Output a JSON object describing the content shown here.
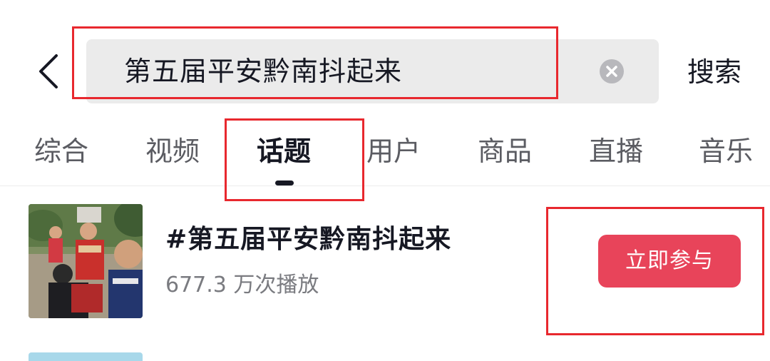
{
  "header": {
    "back_icon": "chevron-left-icon",
    "search_value": "第五届平安黔南抖起来",
    "clear_icon": "close-circle-icon",
    "search_button_label": "搜索"
  },
  "tabs": [
    {
      "label": "综合",
      "active": false
    },
    {
      "label": "视频",
      "active": false
    },
    {
      "label": "话题",
      "active": true
    },
    {
      "label": "用户",
      "active": false
    },
    {
      "label": "商品",
      "active": false
    },
    {
      "label": "直播",
      "active": false
    },
    {
      "label": "音乐",
      "active": false
    }
  ],
  "result": {
    "topic_title": "#第五届平安黔南抖起来",
    "views": "677.3 万次播放",
    "join_button_label": "立即参与"
  },
  "colors": {
    "accent": "#e8445a",
    "highlight_box": "#e8282e",
    "search_bg": "#ebebeb"
  }
}
